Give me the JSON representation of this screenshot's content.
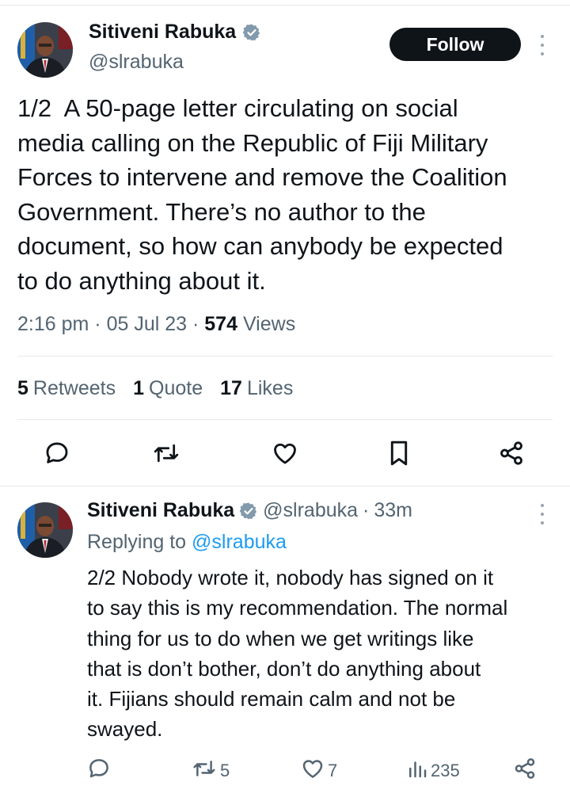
{
  "main_tweet": {
    "author_name": "Sitiveni Rabuka",
    "handle": "@slrabuka",
    "follow_label": "Follow",
    "text": "1/2  A 50-page letter circulating on social\nmedia calling on the Republic of Fiji Military\nForces to intervene and remove the Coalition\nGovernment. There’s no author to the\ndocument, so how can anybody be expected\nto do anything about it.",
    "time": "2:16 pm",
    "date": "05 Jul 23",
    "views_count": "574",
    "views_label": "Views",
    "retweets_count": "5",
    "retweets_label": "Retweets",
    "quotes_count": "1",
    "quotes_label": "Quote",
    "likes_count": "17",
    "likes_label": "Likes",
    "actions": [
      "reply-icon",
      "retweet-icon",
      "like-icon",
      "bookmark-icon",
      "share-icon"
    ]
  },
  "reply_tweet": {
    "author_name": "Sitiveni Rabuka",
    "handle": "@slrabuka",
    "age": "33m",
    "replying_prefix": "Replying to",
    "replying_to": "@slrabuka",
    "text": "2/2 Nobody wrote it, nobody has signed on it\nto say this is my recommendation. The normal\nthing for us to do when we get writings like\nthat is don’t bother, don’t do anything about\nit. Fijians should remain calm and not be\nswayed.",
    "retweet_count": "5",
    "like_count": "7",
    "views_count": "235"
  },
  "colors": {
    "primary_text": "#0f1419",
    "secondary_text": "#536471",
    "link": "#1d9bf0",
    "verified_badge": "#829aab",
    "divider": "#e6e8ea"
  }
}
